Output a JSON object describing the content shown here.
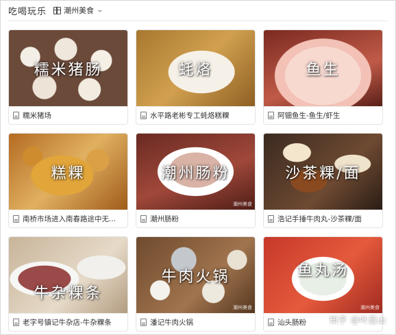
{
  "header": {
    "title": "吃喝玩乐",
    "category": "潮州美食",
    "category_icon": "grid-icon",
    "dropdown_icon": "chevron-down-icon"
  },
  "cards": [
    {
      "overlay": "糯米猪肠",
      "caption": "糯米猪场",
      "watermark": ""
    },
    {
      "overlay": "蚝烙",
      "caption": "水平路老彬专工蚝烙糕粿",
      "watermark": ""
    },
    {
      "overlay": "鱼生",
      "caption": "阿钿鱼生-鱼生/虾生",
      "watermark": ""
    },
    {
      "overlay": "糕粿",
      "caption": "南桥市场进入南春路途中无...",
      "watermark": ""
    },
    {
      "overlay": "潮州肠粉",
      "caption": "潮州肠粉",
      "watermark": "潮州美食"
    },
    {
      "overlay": "沙茶粿/面",
      "caption": "浩记手捶牛肉丸-沙茶粿/面",
      "watermark": ""
    },
    {
      "overlay": "牛杂粿条",
      "caption": "老字号镇记牛杂店-牛杂粿条",
      "watermark": ""
    },
    {
      "overlay": "牛肉火锅",
      "caption": "潘记牛肉火锅",
      "watermark": "潮州美食"
    },
    {
      "overlay": "鱼丸汤",
      "caption": "汕头肠粉",
      "watermark": "潮州美食"
    }
  ],
  "source_watermark": "知乎 @叶蓝山"
}
